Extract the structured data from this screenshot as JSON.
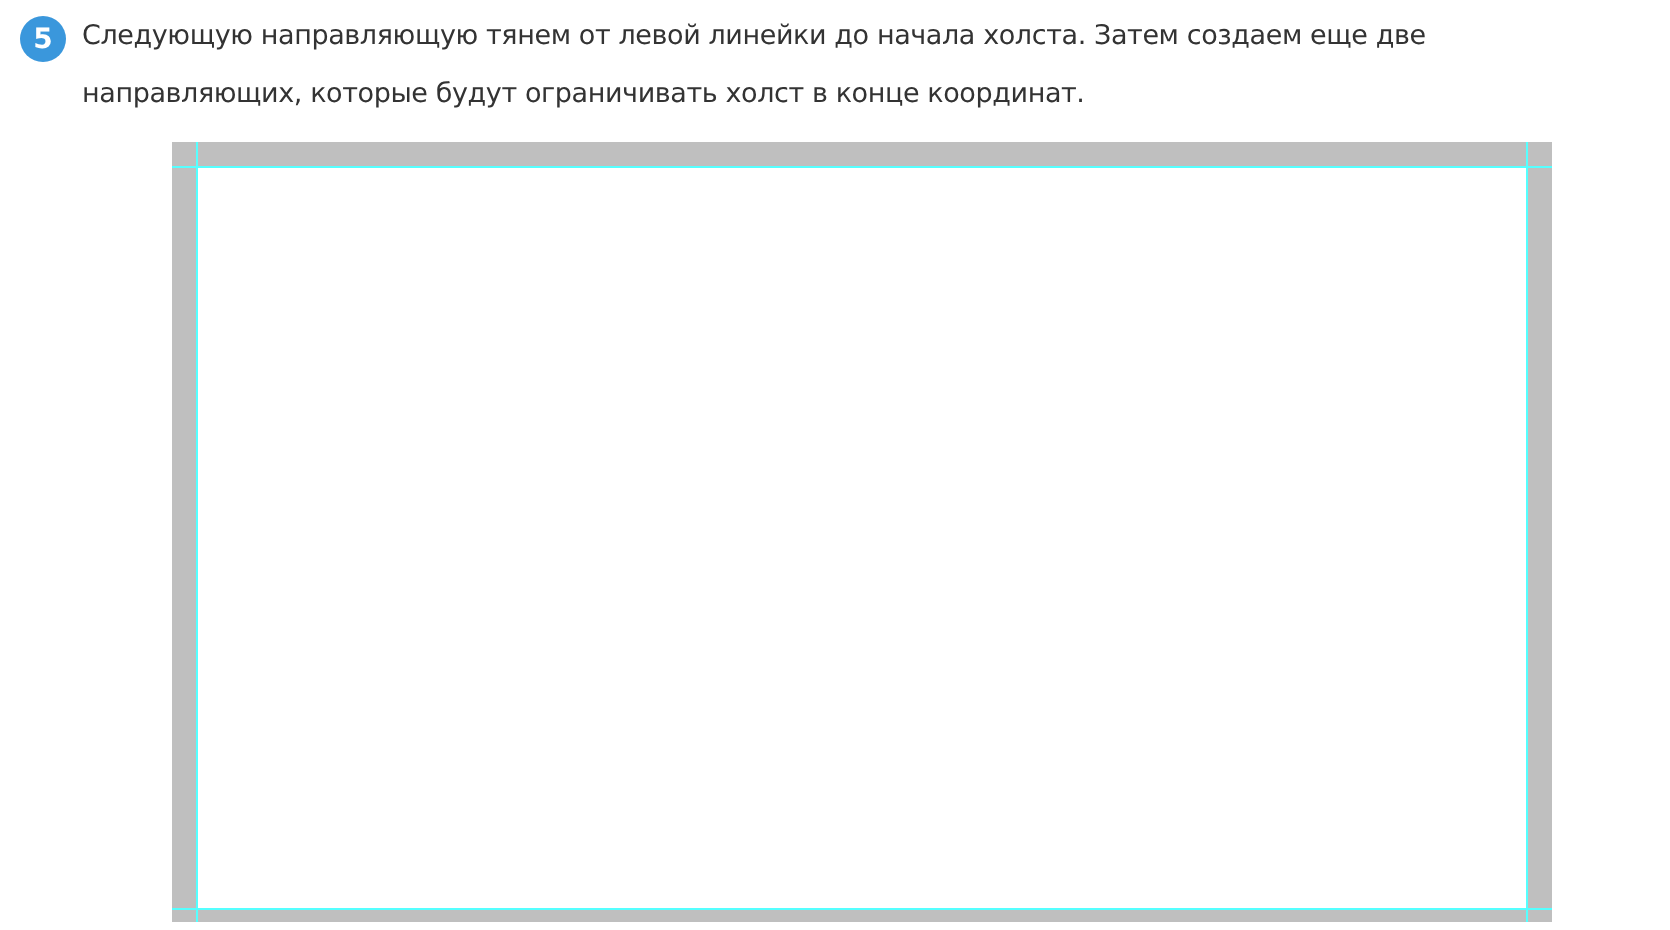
{
  "step": {
    "number": "5",
    "text": "Следующую направляющую тянем от левой линейки до начала холста. Затем создаем еще две направляющих, которые будут ограничивать холст в конце координат."
  }
}
